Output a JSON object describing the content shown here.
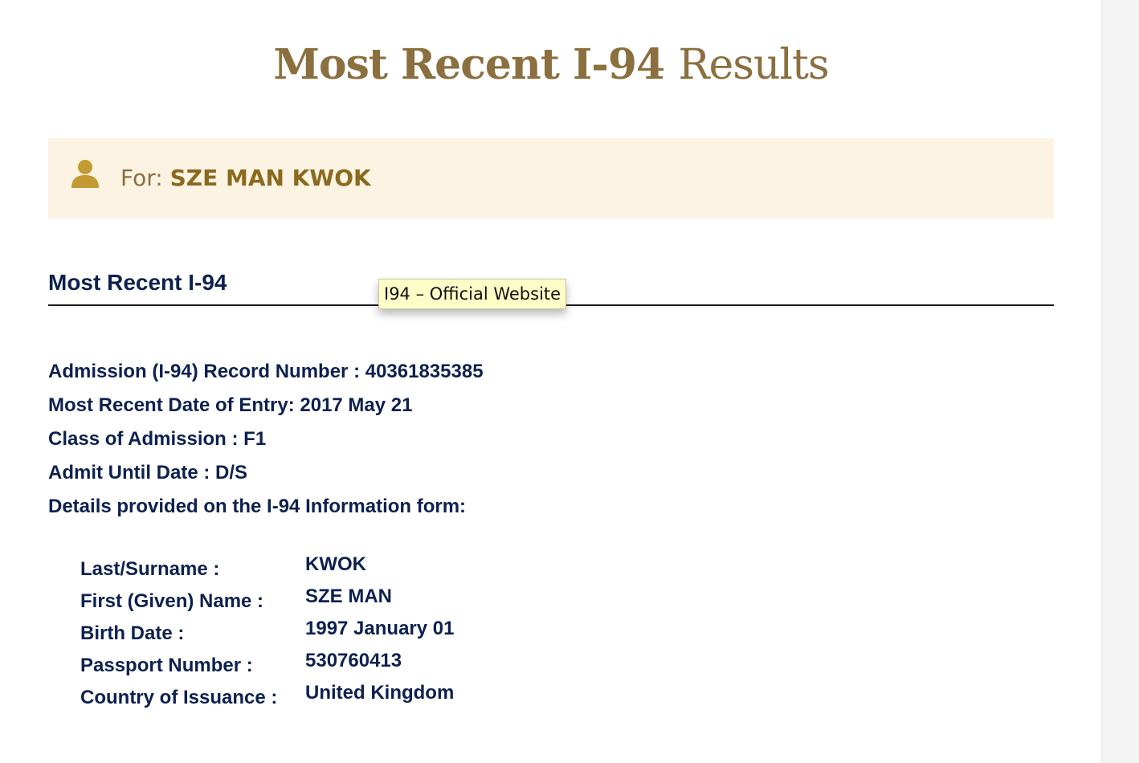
{
  "header": {
    "title_bold": "Most Recent I-94",
    "title_light": "Results"
  },
  "banner": {
    "icon": "user-icon",
    "for_label": "For:",
    "name": "SZE MAN KWOK",
    "background": "#fcf3e3",
    "accent": "#c49a33"
  },
  "section": {
    "heading": "Most Recent I-94"
  },
  "tooltip": {
    "text": "I94 – Official Website"
  },
  "record": {
    "lines": [
      "Admission (I-94) Record Number : 40361835385",
      "Most Recent Date of Entry: 2017 May 21",
      "Class of Admission : F1",
      "Admit Until Date : D/S",
      "Details provided on the I-94 Information form:"
    ]
  },
  "details": [
    {
      "label": "Last/Surname :",
      "value": "KWOK"
    },
    {
      "label": "First (Given) Name :",
      "value": "SZE MAN"
    },
    {
      "label": "Birth Date :",
      "value": "1997 January 01"
    },
    {
      "label": "Passport Number :",
      "value": "530760413"
    },
    {
      "label": "Country of Issuance :",
      "value": "United Kingdom"
    }
  ],
  "colors": {
    "title": "#8b6f3e",
    "text_navy": "#0d2150",
    "tooltip_bg": "#fdfdc8"
  }
}
